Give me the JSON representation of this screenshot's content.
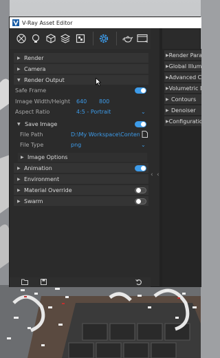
{
  "window": {
    "title": "V-Ray Asset Editor"
  },
  "toolbar": {
    "buttons": [
      "materials-icon",
      "lights-icon",
      "geometry-icon",
      "textures-icon",
      "render-elements-icon",
      "settings-icon",
      "teapot-render-icon",
      "frame-buffer-icon"
    ]
  },
  "left_panel": {
    "rollouts": {
      "render": "Render",
      "camera": "Camera",
      "render_output": "Render Output",
      "animation": "Animation",
      "environment": "Environment",
      "material_override": "Material Override",
      "swarm": "Swarm"
    },
    "render_output": {
      "safe_frame_label": "Safe Frame",
      "safe_frame_on": true,
      "size_label": "Image Width/Height",
      "width": "640",
      "height": "800",
      "aspect_label": "Aspect Ratio",
      "aspect_value": "4:5 - Portrait",
      "save_image_label": "Save Image",
      "save_image_on": true,
      "file_path_label": "File Path",
      "file_path_value": "D:\\My Workspace\\Content\\Re...",
      "file_type_label": "File Type",
      "file_type_value": "png",
      "image_options_label": "Image Options"
    },
    "toggles": {
      "animation_on": true,
      "material_override_on": false,
      "swarm_on": false
    }
  },
  "right_panel": {
    "rollouts": [
      "Render Parameters",
      "Global Illumination",
      "Advanced Camera",
      "Volumetric Environment",
      "Contours",
      "Denoiser",
      "Configuration"
    ]
  },
  "colors": {
    "accent": "#3d9be9",
    "panel": "#2b2b2b",
    "rollout": "#343434"
  }
}
